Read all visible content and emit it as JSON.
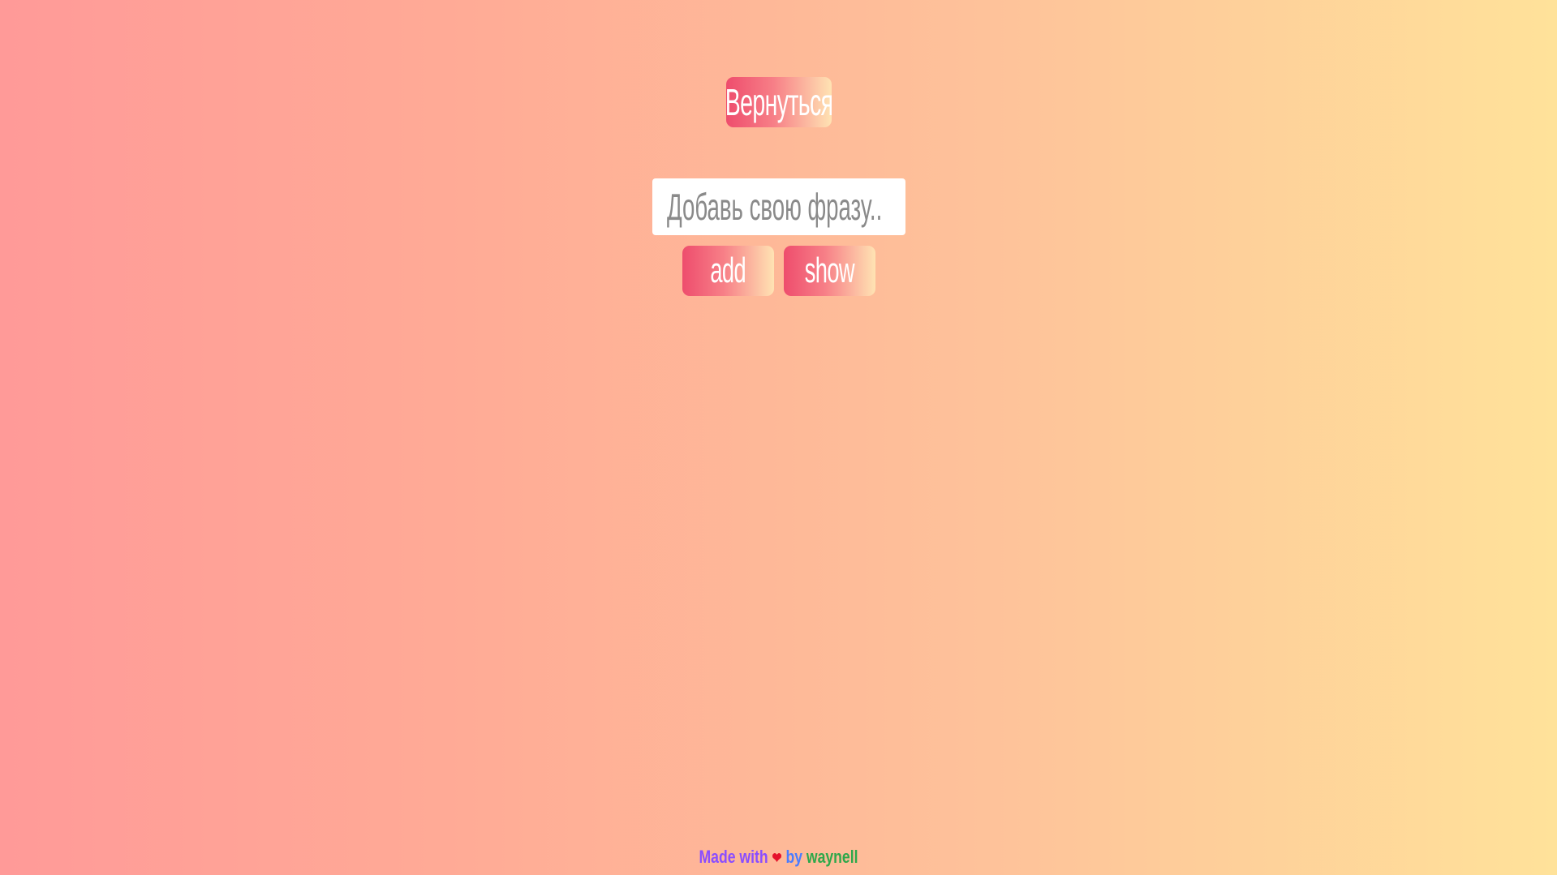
{
  "back_button": {
    "label": "Вернуться"
  },
  "phrase_input": {
    "placeholder": "Добавь свою фразу..",
    "value": ""
  },
  "actions": {
    "add_label": "add",
    "show_label": "show"
  },
  "footer": {
    "made_with": "Made with",
    "heart": "❤",
    "by": "by",
    "author": "waynell",
    "colors": {
      "made_with": "#8a4dff",
      "heart": "#e5122b",
      "by": "#4a7cff",
      "author": "#2ea84a"
    }
  },
  "theme": {
    "background_gradient": [
      "#ff9a98",
      "#ffab96",
      "#fec39a",
      "#ffe29a"
    ],
    "button_gradient": [
      "#ee4d6d",
      "#f77f87",
      "#ffe3b3"
    ]
  }
}
